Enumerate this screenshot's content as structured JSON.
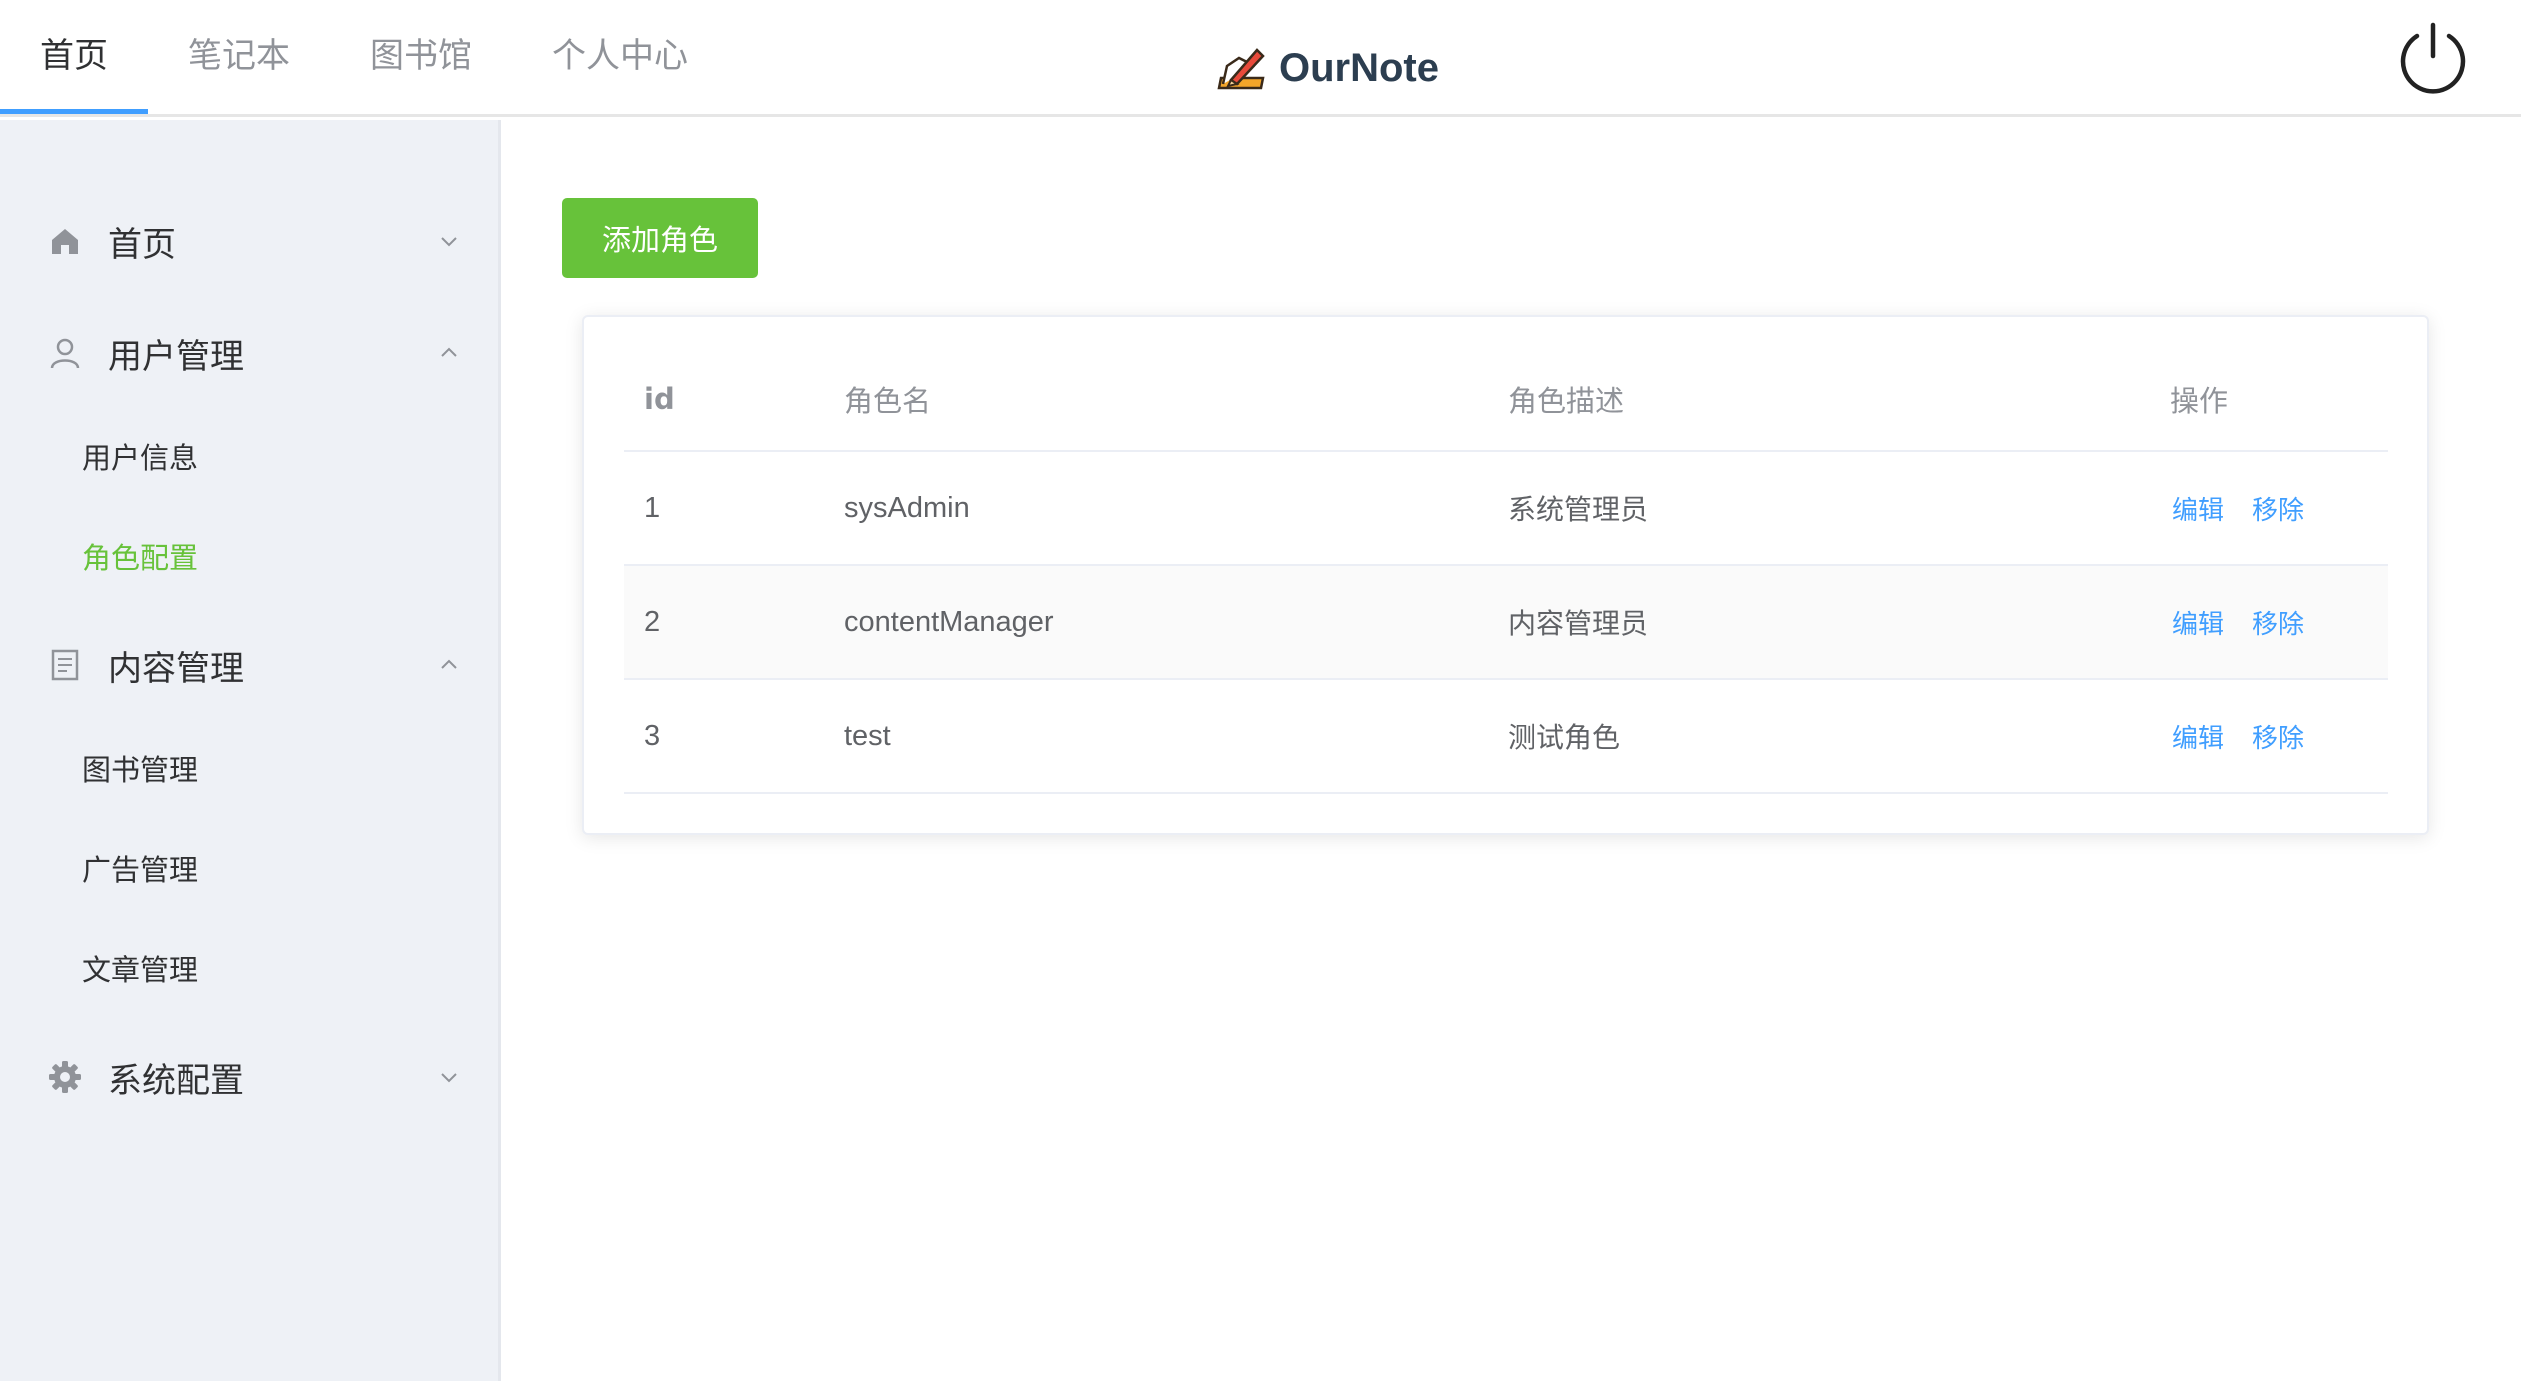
{
  "header": {
    "nav": [
      {
        "label": "首页",
        "active": true
      },
      {
        "label": "笔记本",
        "active": false
      },
      {
        "label": "图书馆",
        "active": false
      },
      {
        "label": "个人中心",
        "active": false
      }
    ],
    "brand": "OurNote",
    "logo_icon": "pencil-notebook-icon",
    "power_icon": "power-icon"
  },
  "sidebar": {
    "home": {
      "label": "首页",
      "icon": "home-icon",
      "expanded": false
    },
    "user_mgmt": {
      "label": "用户管理",
      "icon": "user-icon",
      "expanded": true,
      "items": [
        {
          "label": "用户信息",
          "active": false
        },
        {
          "label": "角色配置",
          "active": true
        }
      ]
    },
    "content_mgmt": {
      "label": "内容管理",
      "icon": "document-icon",
      "expanded": true,
      "items": [
        {
          "label": "图书管理",
          "active": false
        },
        {
          "label": "广告管理",
          "active": false
        },
        {
          "label": "文章管理",
          "active": false
        }
      ]
    },
    "system_config": {
      "label": "系统配置",
      "icon": "gear-icon",
      "expanded": false
    },
    "active_color": "#67c23a"
  },
  "main": {
    "add_button_label": "添加角色",
    "table": {
      "columns": {
        "id": "id",
        "name": "角色名",
        "description": "角色描述",
        "actions": "操作"
      },
      "rows": [
        {
          "id": "1",
          "name": "sysAdmin",
          "description": "系统管理员",
          "edit": "编辑",
          "remove": "移除"
        },
        {
          "id": "2",
          "name": "contentManager",
          "description": "内容管理员",
          "edit": "编辑",
          "remove": "移除"
        },
        {
          "id": "3",
          "name": "test",
          "description": "测试角色",
          "edit": "编辑",
          "remove": "移除"
        }
      ]
    }
  },
  "colors": {
    "accent": "#409eff",
    "success": "#67c23a",
    "sidebar_bg": "#eef1f6"
  }
}
